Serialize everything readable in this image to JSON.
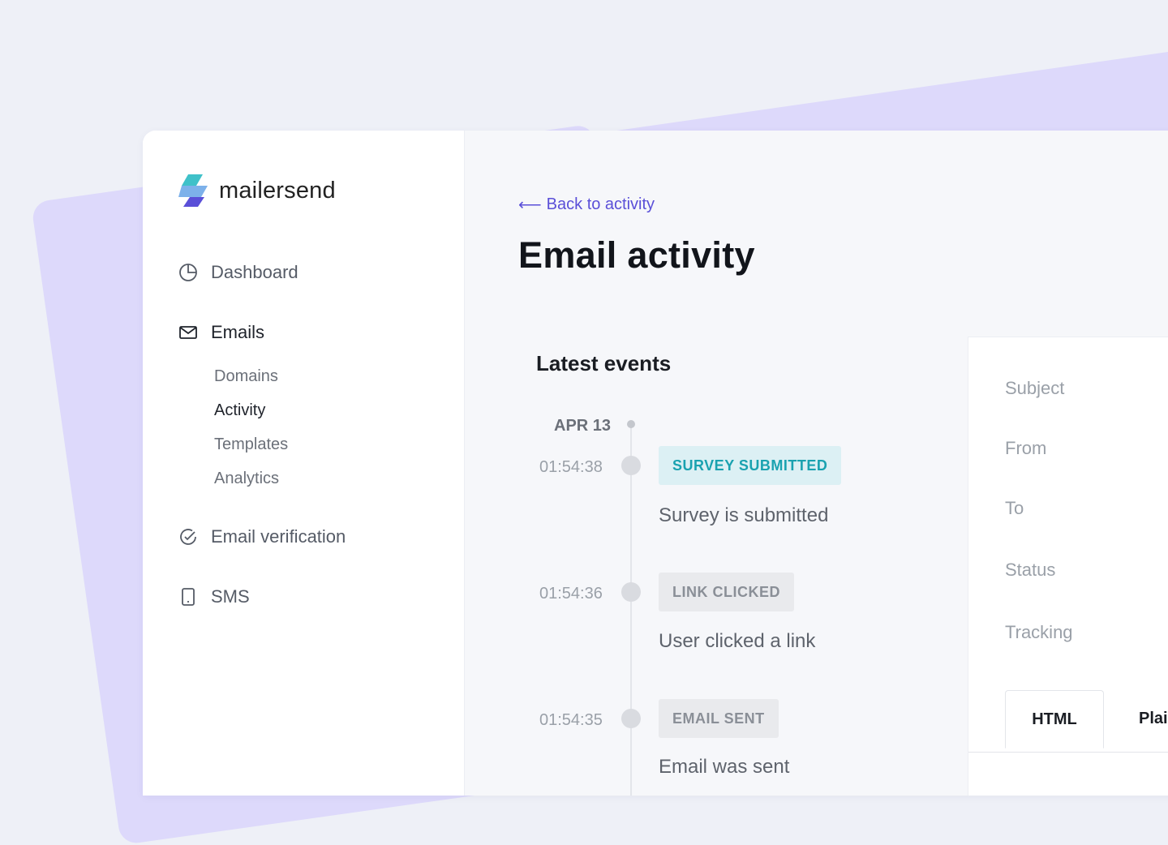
{
  "brand": {
    "name": "mailersend"
  },
  "sidebar": {
    "items": [
      {
        "label": "Dashboard",
        "icon": "pie-chart-icon"
      },
      {
        "label": "Emails",
        "icon": "envelope-icon"
      },
      {
        "label": "Email verification",
        "icon": "check-circle-icon"
      },
      {
        "label": "SMS",
        "icon": "phone-icon"
      }
    ],
    "email_sub": [
      "Domains",
      "Activity",
      "Templates",
      "Analytics"
    ],
    "active_sub": "Activity"
  },
  "main": {
    "back_link": "Back to activity",
    "title": "Email activity",
    "section_title": "Latest events",
    "date": "APR 13",
    "events": [
      {
        "time": "01:54:38",
        "badge": "SURVEY SUBMITTED",
        "description": "Survey is submitted",
        "style": "teal"
      },
      {
        "time": "01:54:36",
        "badge": "LINK CLICKED",
        "description": "User clicked a link",
        "style": "gray"
      },
      {
        "time": "01:54:35",
        "badge": "EMAIL SENT",
        "description": "Email was sent",
        "style": "gray"
      }
    ]
  },
  "details": {
    "labels": [
      "Subject",
      "From",
      "To",
      "Status",
      "Tracking"
    ],
    "tabs": [
      "HTML",
      "Plai"
    ]
  },
  "colors": {
    "accent": "#5a4fd8",
    "teal_badge_text": "#1aa2b0",
    "teal_badge_bg": "#dcf0f4",
    "background_purple": "#ddd9fb"
  }
}
